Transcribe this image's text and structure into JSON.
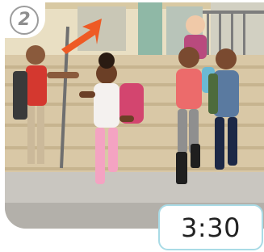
{
  "step": {
    "number": "2",
    "icon": "step-number-badge"
  },
  "media": {
    "scene": "kids-running-down-school-steps",
    "pointer_icon": "orange-arrow-icon",
    "pointer_color": "#ee5a24"
  },
  "duration": {
    "label": "3:30",
    "border_color": "#a9dbe6"
  }
}
